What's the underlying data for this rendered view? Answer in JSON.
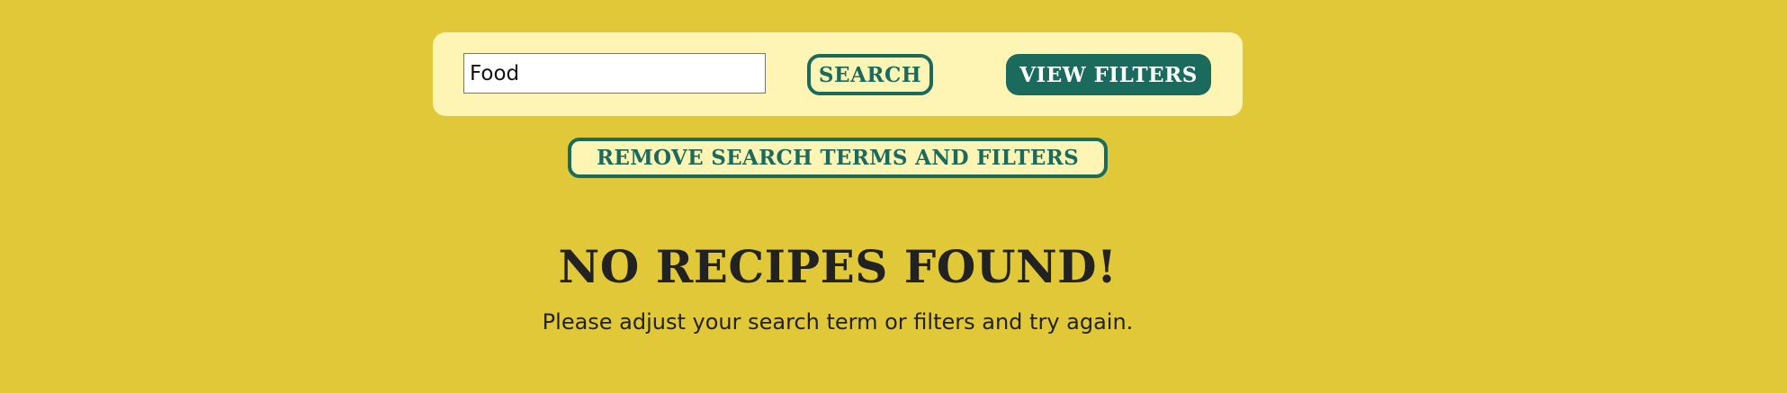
{
  "search": {
    "value": "Food",
    "button_label": "Search"
  },
  "filters": {
    "view_label": "View Filters",
    "remove_label": "Remove search terms and filters"
  },
  "results": {
    "title": "No recipes found!",
    "message": "Please adjust your search term or filters and try again."
  },
  "colors": {
    "page_background": "#e0c838",
    "panel_background": "#fef4b4",
    "accent": "#1a6b5e",
    "text": "#222222"
  }
}
